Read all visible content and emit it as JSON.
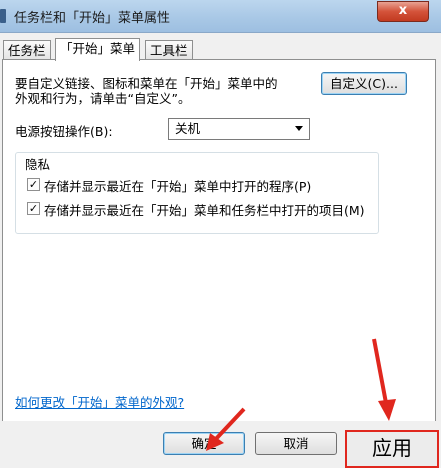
{
  "window": {
    "title": "任务栏和「开始」菜单属性",
    "close_label": "x"
  },
  "tabs": [
    {
      "label": "任务栏",
      "active": false
    },
    {
      "label": "「开始」菜单",
      "active": true
    },
    {
      "label": "工具栏",
      "active": false
    }
  ],
  "panel": {
    "description_line1": "要自定义链接、图标和菜单在「开始」菜单中的",
    "description_line2": "外观和行为，请单击“自定义”。",
    "customize_button": "自定义(C)...",
    "power_label": "电源按钮操作(B):",
    "power_value": "关机",
    "privacy": {
      "title": "隐私",
      "option1": "存储并显示最近在「开始」菜单中打开的程序(P)",
      "option1_checked": true,
      "option2": "存储并显示最近在「开始」菜单和任务栏中打开的项目(M)",
      "option2_checked": true
    },
    "help_link": "如何更改「开始」菜单的外观?"
  },
  "footer": {
    "ok_label": "确定",
    "cancel_label": "取消",
    "apply_label": "应用"
  },
  "colors": {
    "annotation": "#e0271e",
    "link": "#0066cc"
  }
}
